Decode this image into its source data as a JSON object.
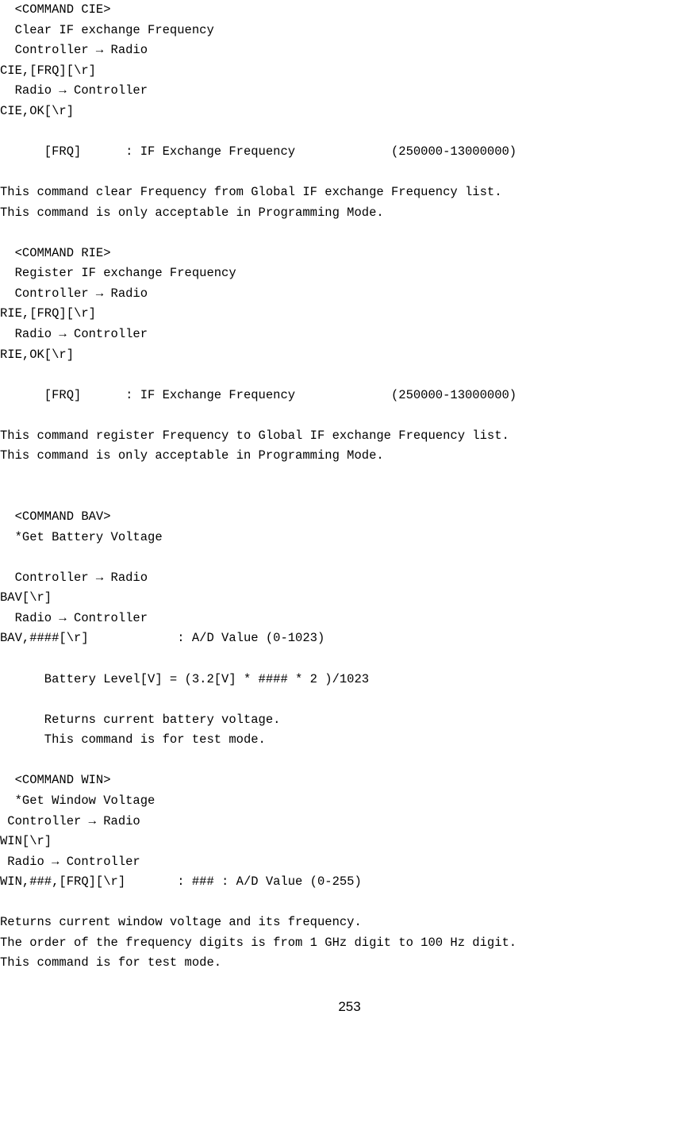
{
  "cie": {
    "header": "  <COMMAND CIE>",
    "title": "  Clear IF exchange Frequency",
    "dir1": "  Controller → Radio",
    "cmd1": "CIE,[FRQ][\\r]",
    "dir2": "  Radio → Controller",
    "cmd2": "CIE,OK[\\r]",
    "param": "      [FRQ]      : IF Exchange Frequency             (250000-13000000)",
    "desc1": "This command clear Frequency from Global IF exchange Frequency list.",
    "desc2": "This command is only acceptable in Programming Mode."
  },
  "rie": {
    "header": "  <COMMAND RIE>",
    "title": "  Register IF exchange Frequency",
    "dir1": "  Controller → Radio",
    "cmd1": "RIE,[FRQ][\\r]",
    "dir2": "  Radio → Controller",
    "cmd2": "RIE,OK[\\r]",
    "param": "      [FRQ]      : IF Exchange Frequency             (250000-13000000)",
    "desc1": "This command register Frequency to Global IF exchange Frequency list.",
    "desc2": "This command is only acceptable in Programming Mode."
  },
  "bav": {
    "header": "  <COMMAND BAV>",
    "title": "  *Get Battery Voltage",
    "dir1": "  Controller → Radio",
    "cmd1": "BAV[\\r]",
    "dir2": "  Radio → Controller",
    "cmd2": "BAV,####[\\r]            : A/D Value (0-1023)",
    "formula": "      Battery Level[V] = (3.2[V] * #### * 2 )/1023",
    "desc1": "      Returns current battery voltage.",
    "desc2": "      This command is for test mode."
  },
  "win": {
    "header": "  <COMMAND WIN>",
    "title": "  *Get Window Voltage",
    "dir1": " Controller → Radio",
    "cmd1": "WIN[\\r]",
    "dir2": " Radio → Controller",
    "cmd2": "WIN,###,[FRQ][\\r]       : ### : A/D Value (0-255)",
    "desc1": "Returns current window voltage and its frequency.",
    "desc2": "The order of the frequency digits is from 1 GHz digit to 100 Hz digit.",
    "desc3": "This command is for test mode."
  },
  "page_number": "253"
}
